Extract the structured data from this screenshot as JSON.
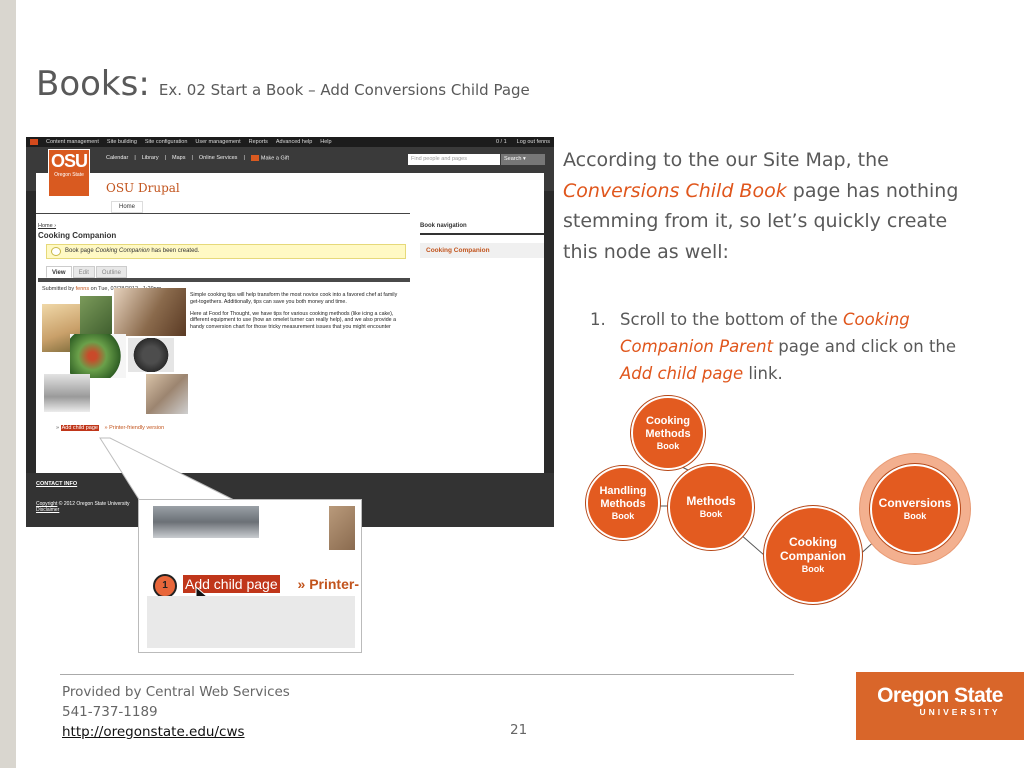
{
  "slide": {
    "title": "Books:",
    "subtitle": "Ex. 02 Start a Book – Add Conversions Child Page"
  },
  "screenshot": {
    "admin_menu": [
      "Content management",
      "Site building",
      "Site configuration",
      "User management",
      "Reports",
      "Advanced help",
      "Help"
    ],
    "admin_user_count": "0 / 1",
    "logout": "Log out fenns",
    "top_nav": [
      "Calendar",
      "|",
      "Library",
      "|",
      "Maps",
      "|",
      "Online Services",
      "|"
    ],
    "gift_link": "Make a Gift",
    "search_placeholder": "Find people and pages",
    "search_button": "Search",
    "logo_text": "OSU",
    "logo_sub": "Oregon State",
    "site_name": "OSU Drupal",
    "home_tab": "Home",
    "breadcrumb": "Home ›",
    "page_heading": "Cooking Companion",
    "status_prefix": "Book page ",
    "status_em": "Cooking Companion",
    "status_suffix": " has been created.",
    "tabs": [
      "View",
      "Edit",
      "Outline"
    ],
    "submitted_prefix": "Submitted by ",
    "submitted_author": "fenns",
    "submitted_suffix": " on Tue, 02/28/2012 - 1:29pm",
    "body_p1": "Simple cooking tips will help transform the most novice cook into a favored chef at family get-togethers. Additionally, tips can save you both money and time.",
    "body_p2": "Here at Food for Thought, we have tips for various cooking methods (like icing a cake), different equipment to use (how an omelet turner can really help), and we also provide a handy conversion chart for those tricky measurement issues that you might encounter",
    "add_child_link": "Add child page",
    "printer_link": "Printer-friendly version",
    "link_sep": "»",
    "sidebar_title": "Book navigation",
    "sidebar_link": "Cooking Companion",
    "footer_contact": "CONTACT INFO",
    "footer_copyright": "Copyright",
    "footer_copy_rest": " ©  2012 Oregon State University",
    "footer_disclaimer": "Disclaimer"
  },
  "callout": {
    "step_number": "1",
    "add_child_label": "Add child page",
    "printer_label": "» Printer-"
  },
  "instructions": {
    "intro_a": "According to the our Site Map, the ",
    "intro_hl": "Conversions Child Book",
    "intro_b": " page has nothing stemming from it, so let’s quickly create this node as well:",
    "step_num": "1.",
    "step_a": "Scroll to the bottom of the ",
    "step_hl1": "Cooking Companion Parent",
    "step_b": " page and click on the ",
    "step_hl2": "Add child page",
    "step_c": " link."
  },
  "sitemap": {
    "cooking_methods": {
      "title": "Cooking Methods",
      "sub": "Book"
    },
    "handling_methods": {
      "title": "Handling Methods",
      "sub": "Book"
    },
    "methods": {
      "title": "Methods",
      "sub": "Book"
    },
    "cooking_companion": {
      "title": "Cooking Companion",
      "sub": "Book"
    },
    "conversions": {
      "title": "Conversions",
      "sub": "Book"
    }
  },
  "footer": {
    "provider": "Provided by Central Web Services",
    "phone": "541-737-1189",
    "url": "http://oregonstate.edu/cws",
    "page_number": "21",
    "brand_name": "Oregon State",
    "brand_sub": "UNIVERSITY"
  },
  "colors": {
    "accent_orange": "#e0561c",
    "bubble_orange": "#e35b20",
    "brand_orange": "#d9662a"
  }
}
